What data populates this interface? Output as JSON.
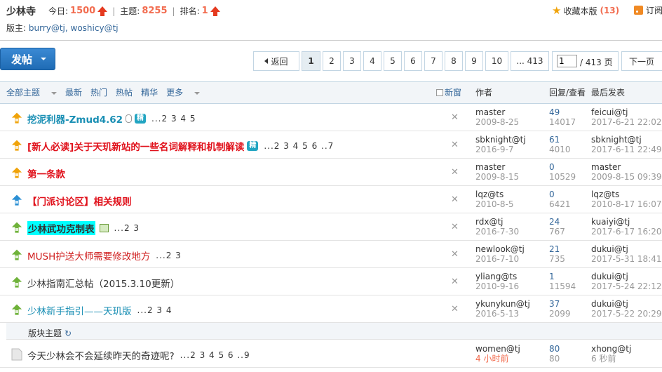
{
  "header": {
    "forum_name": "少林寺",
    "today_label": "今日:",
    "today_value": "1500",
    "threads_label": "主题:",
    "threads_value": "8255",
    "rank_label": "排名:",
    "rank_value": "1",
    "mods_label": "版主:",
    "mods": "burry@tj, woshicy@tj",
    "fav_label": "收藏本版",
    "fav_count": "(13)",
    "rss_label": "订阅"
  },
  "toolbar": {
    "post_label": "发帖",
    "back_label": "返回",
    "pages": [
      "1",
      "2",
      "3",
      "4",
      "5",
      "6",
      "7",
      "8",
      "9",
      "10"
    ],
    "last_page_label": "... 413",
    "page_input_value": "1",
    "total_pages": "/ 413 页",
    "next_label": "下一页"
  },
  "table_header": {
    "filters": [
      "全部主题",
      "最新",
      "热门",
      "热帖",
      "精华",
      "更多"
    ],
    "new_window": "新窗",
    "author": "作者",
    "reply_view": "回复/查看",
    "last_post": "最后发表"
  },
  "rows": [
    {
      "title": "挖泥利器-Zmud4.62",
      "pages": "...2 3 4 5",
      "author": "master",
      "date": "2009-8-25",
      "replies": "49",
      "views": "14017",
      "last_user": "feicui@tj",
      "last_time": "2017-6-21 22:02",
      "badge": "精"
    },
    {
      "title": "[新人必读]关于天玑新站的一些名词解释和机制解读",
      "pages": "...2 3 4 5 6 ..7",
      "author": "sbknight@tj",
      "date": "2016-9-7",
      "replies": "61",
      "views": "4010",
      "last_user": "sbknight@tj",
      "last_time": "2017-6-11 22:49",
      "badge": "精"
    },
    {
      "title": "第一条款",
      "pages": "",
      "author": "master",
      "date": "2009-8-15",
      "replies": "0",
      "views": "10529",
      "last_user": "master",
      "last_time": "2009-8-15 09:39",
      "badge": ""
    },
    {
      "title": "【门派讨论区】相关规则",
      "pages": "",
      "author": "lqz@ts",
      "date": "2010-8-5",
      "replies": "0",
      "views": "6421",
      "last_user": "lqz@ts",
      "last_time": "2010-8-17 16:07",
      "badge": ""
    },
    {
      "title": "少林武功克制表",
      "pages": "...2 3",
      "author": "rdx@tj",
      "date": "2016-7-30",
      "replies": "24",
      "views": "767",
      "last_user": "kuaiyi@tj",
      "last_time": "2017-6-17 16:20",
      "badge": ""
    },
    {
      "title": "MUSH护送大师需要修改地方",
      "pages": "...2 3",
      "author": "newlook@tj",
      "date": "2016-7-10",
      "replies": "21",
      "views": "735",
      "last_user": "dukui@tj",
      "last_time": "2017-5-31 18:41",
      "badge": ""
    },
    {
      "title": "少林指南汇总帖（2015.3.10更新）",
      "pages": "",
      "author": "yliang@ts",
      "date": "2010-9-16",
      "replies": "1",
      "views": "11594",
      "last_user": "dukui@tj",
      "last_time": "2017-5-24 22:12",
      "badge": ""
    },
    {
      "title": "少林新手指引——天玑版",
      "pages": "...2 3 4",
      "author": "ykunykun@tj",
      "date": "2016-5-13",
      "replies": "37",
      "views": "2099",
      "last_user": "dukui@tj",
      "last_time": "2017-5-22 20:29",
      "badge": ""
    }
  ],
  "section": {
    "label": "版块主题",
    "refresh": "↻"
  },
  "normal_rows": [
    {
      "title": "今天少林会不会延续昨天的奇迹呢?",
      "pages": "...2 3 4 5 6 ..9",
      "author": "women@tj",
      "date": "4 小时前",
      "replies": "80",
      "views": "80",
      "last_user": "xhong@tj",
      "last_time": "6 秒前"
    }
  ],
  "colors": {
    "link_blue": "#336699",
    "title_teal": "#1a8fb4",
    "title_red": "#e0101a",
    "highlight_cyan": "#00ffff",
    "accent_orange": "#f26c4f"
  },
  "icons": [
    "up-arrow-icon",
    "star-icon",
    "rss-icon",
    "pin-icon",
    "close-icon",
    "attachment-icon",
    "image-icon",
    "refresh-icon",
    "topic-icon"
  ]
}
